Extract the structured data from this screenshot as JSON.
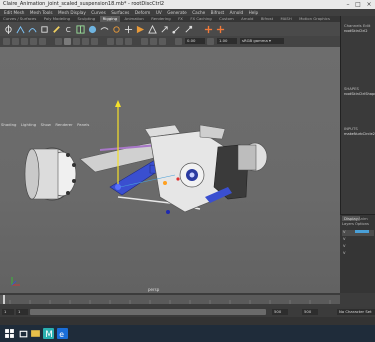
{
  "titlebar": {
    "title": "Claire_Animation_joint_scaled_suspension18.mb* - rootDiscCtrl2"
  },
  "menubar": [
    "Edit Mesh",
    "Mesh Tools",
    "Mesh Display",
    "Curves",
    "Surfaces",
    "Deform",
    "UV",
    "Generate",
    "Cache",
    "Bifrost",
    "Arnold",
    "Help"
  ],
  "shelftabs": {
    "items": [
      "Curves / Surfaces",
      "Poly Modeling",
      "Sculpting",
      "Rigging",
      "Animation",
      "Rendering",
      "FX",
      "FX Caching",
      "Custom",
      "Arnold",
      "Bifrost",
      "MASH",
      "Motion Graphics"
    ],
    "active": "Rigging"
  },
  "toolbar": {
    "gamma": "sRGB gamma"
  },
  "viewport": {
    "panel_menu": [
      "Shading",
      "Lighting",
      "Show",
      "Renderer",
      "Panels"
    ],
    "camera_label": "persp"
  },
  "right_panel": {
    "tabs": [
      "Channels",
      "Edit"
    ],
    "node": "rootSkinCtrl2",
    "shapes_header": "SHAPES",
    "shape_name": "rootSkinCtrlShape2",
    "inputs_header": "INPUTS",
    "input_name": "makeNurbCircle2"
  },
  "layer_editor": {
    "tabs": [
      "Display",
      "Anim"
    ],
    "menu": [
      "Layers",
      "Options",
      "Help"
    ],
    "rows": [
      "V",
      "V",
      "V",
      "V"
    ]
  },
  "range": {
    "start": "1",
    "end": "500",
    "total": "500",
    "char_set": "No Character Set"
  },
  "colors": {
    "accent": "#4aa0d8",
    "viewport": "#6a6a6a",
    "taskbar": "#1f2c3a"
  }
}
